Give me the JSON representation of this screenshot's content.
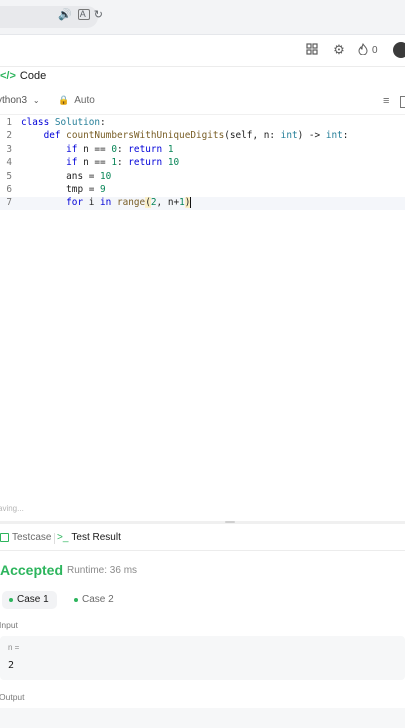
{
  "browser": {
    "icons": [
      "speaker-icon",
      "translate-icon",
      "refresh-icon"
    ]
  },
  "header": {
    "streak_count": "0"
  },
  "code_panel": {
    "tab_label": "Code",
    "language": "ython3",
    "auto_label": "Auto",
    "lines": [
      {
        "n": "1"
      },
      {
        "n": "2"
      },
      {
        "n": "3"
      },
      {
        "n": "4"
      },
      {
        "n": "5"
      },
      {
        "n": "6"
      },
      {
        "n": "7"
      }
    ],
    "status": "aving..."
  },
  "result_panel": {
    "tab_testcase": "Testcase",
    "tab_result": "Test Result",
    "status": "Accepted",
    "runtime": "Runtime: 36 ms",
    "cases": [
      "Case 1",
      "Case 2"
    ],
    "input_label": "Input",
    "param_name": "n =",
    "param_value": "2",
    "output_label": "Output"
  },
  "colors": {
    "accent_green": "#2db55d",
    "keyword": "#0000d8",
    "number": "#098658"
  }
}
